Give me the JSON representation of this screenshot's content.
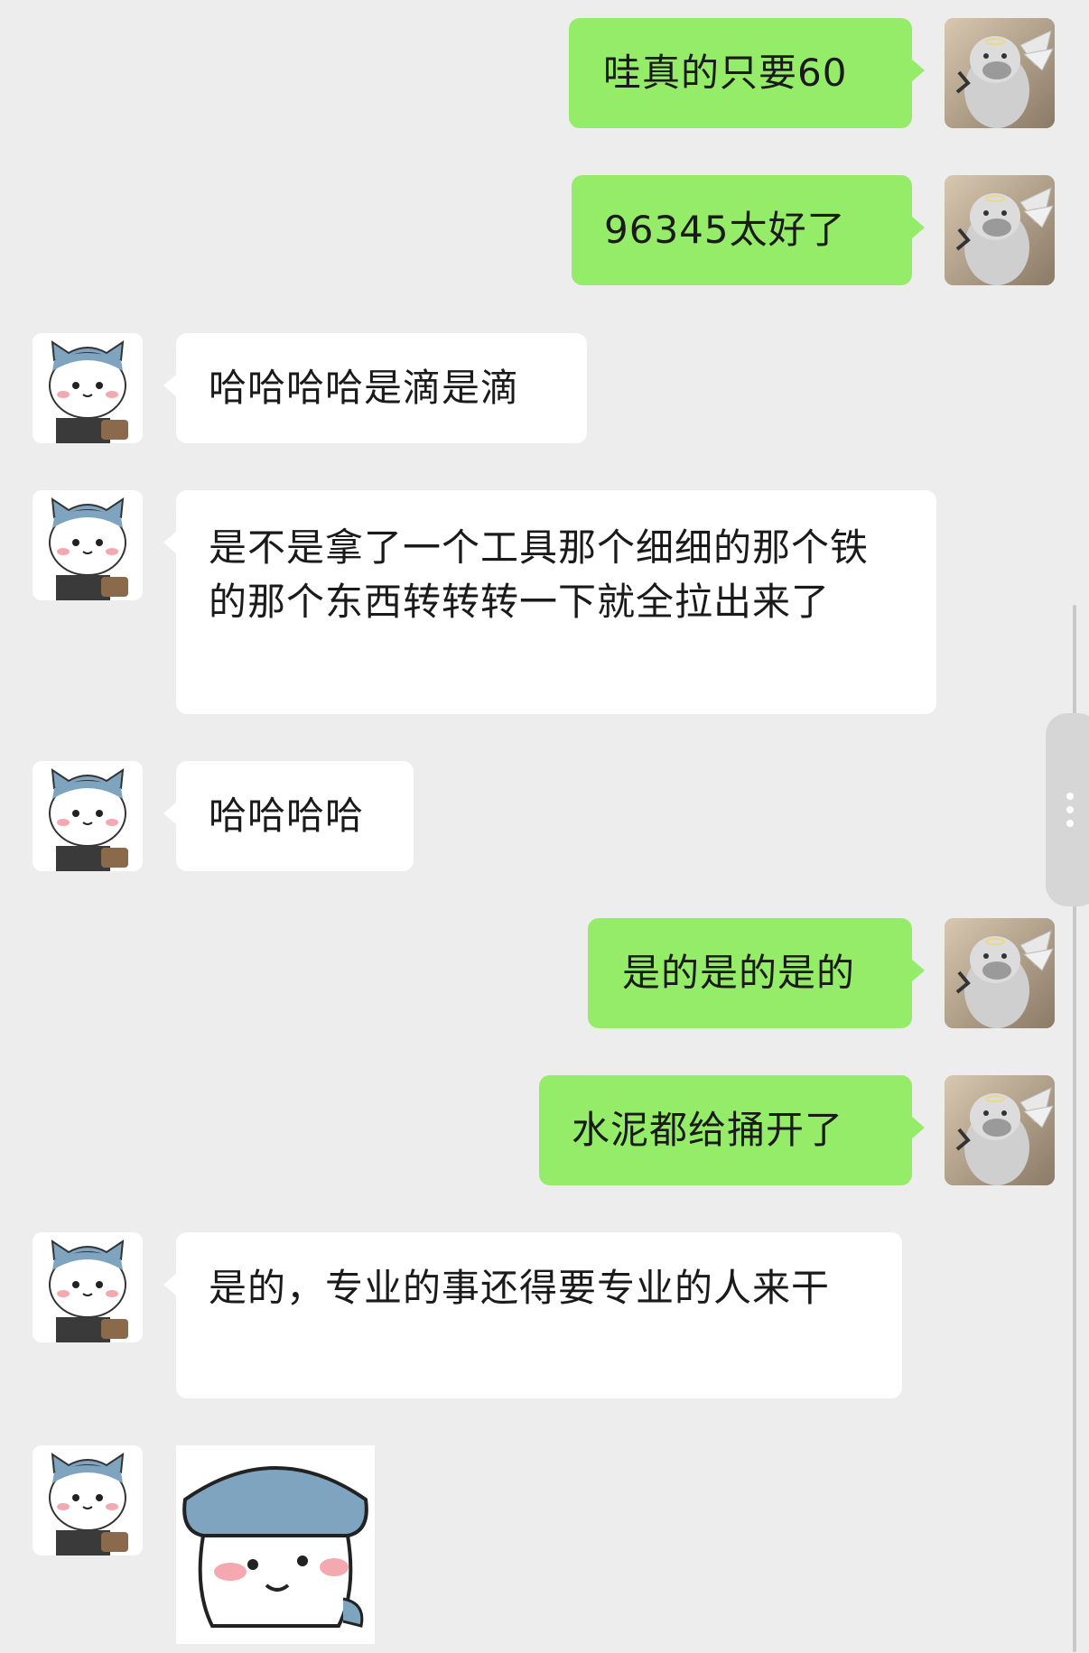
{
  "conversation": {
    "messages": [
      {
        "side": "mine",
        "text": "哇真的只要60"
      },
      {
        "side": "mine",
        "text": "96345太好了"
      },
      {
        "side": "theirs",
        "text": "哈哈哈哈是滴是滴"
      },
      {
        "side": "theirs",
        "text": "是不是拿了一个工具那个细细的那个铁的那个东西转转转一下就全拉出来了"
      },
      {
        "side": "theirs",
        "text": "哈哈哈哈"
      },
      {
        "side": "mine",
        "text": "是的是的是的"
      },
      {
        "side": "mine",
        "text": "水泥都给捅开了"
      },
      {
        "side": "theirs",
        "text": "是的，专业的事还得要专业的人来干"
      },
      {
        "side": "theirs",
        "type": "sticker",
        "sticker": "cat-character-sticker"
      }
    ]
  },
  "avatars": {
    "mine": "seal-avatar-icon",
    "theirs": "cat-avatar-icon"
  },
  "colors": {
    "background": "#ededed",
    "mine_bubble": "#95ec69",
    "theirs_bubble": "#ffffff"
  }
}
